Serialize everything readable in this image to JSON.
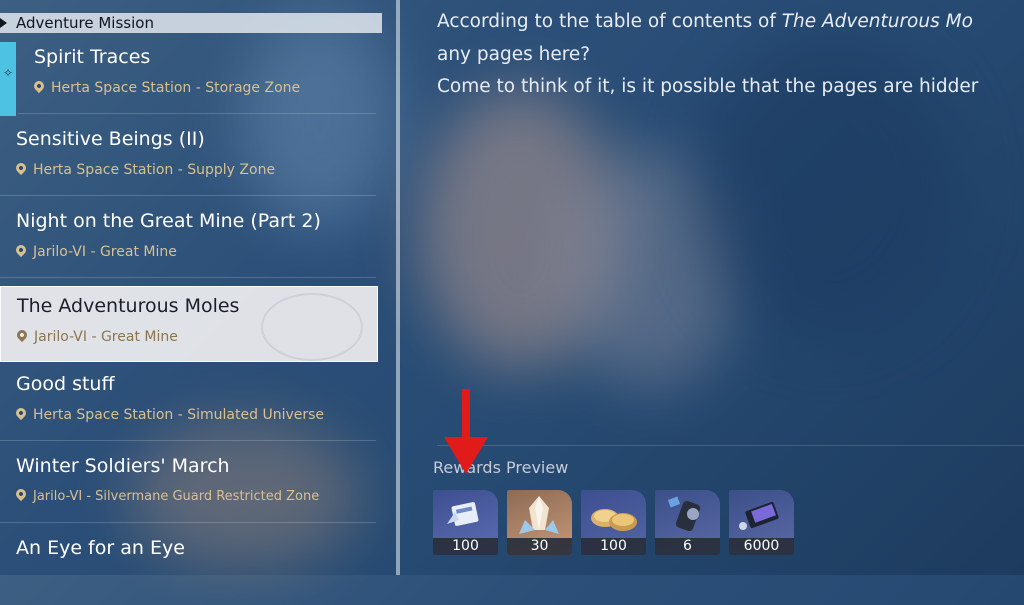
{
  "sidebar": {
    "header": "Adventure Mission",
    "missions": [
      {
        "title": "Spirit Traces",
        "location": "Herta Space Station - Storage Zone"
      },
      {
        "title": "Sensitive Beings (II)",
        "location": "Herta Space Station - Supply Zone"
      },
      {
        "title": "Night on the Great Mine (Part 2)",
        "location": "Jarilo-VI - Great Mine"
      },
      {
        "title": "The Adventurous Moles",
        "location": "Jarilo-VI - Great Mine"
      },
      {
        "title": "Good stuff",
        "location": "Herta Space Station - Simulated Universe"
      },
      {
        "title": "Winter Soldiers' March",
        "location": "Jarilo-VI - Silvermane Guard Restricted Zone"
      },
      {
        "title": "An Eye for an Eye",
        "location": ""
      }
    ],
    "selected_index": 3
  },
  "description": {
    "line1_prefix": "According to the table of contents of ",
    "line1_italic": "The Adventurous Mo",
    "line2": "any pages here?",
    "line3": "Come to think of it, is it possible that the pages are hidder"
  },
  "rewards": {
    "title": "Rewards Preview",
    "items": [
      {
        "icon": "pass-ticket-icon",
        "qty": "100"
      },
      {
        "icon": "crystal-icon",
        "qty": "30"
      },
      {
        "icon": "credits-coins-icon",
        "qty": "100"
      },
      {
        "icon": "fuel-canister-icon",
        "qty": "6"
      },
      {
        "icon": "ticket-card-icon",
        "qty": "6000"
      }
    ]
  },
  "annotation": {
    "type": "red-arrow",
    "color": "#e11a1a",
    "points_to": "rewards-item-1"
  },
  "colors": {
    "accent_location": "#d9c08f",
    "tracked_bar": "#4ec2e2",
    "arrow": "#e11a1a"
  }
}
